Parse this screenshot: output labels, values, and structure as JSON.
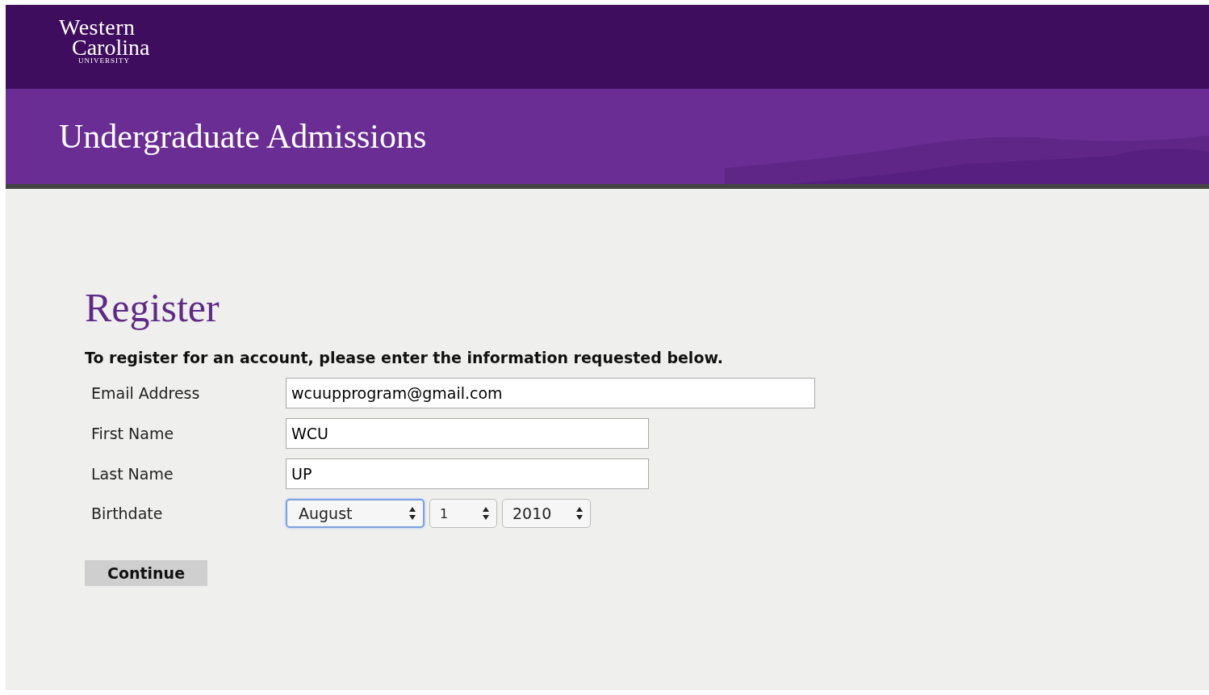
{
  "header": {
    "logo": {
      "line_1": "Western",
      "line_2": "Carolina",
      "line_3": "UNIVERSITY"
    }
  },
  "banner": {
    "title": "Undergraduate Admissions"
  },
  "form": {
    "title": "Register",
    "intro": "To register for an account, please enter the information requested below.",
    "fields": [
      {
        "label": "Email Address",
        "kind": "text",
        "value": "wcuupprogram@gmail.com"
      },
      {
        "label": "First Name",
        "kind": "text",
        "value": "WCU"
      },
      {
        "label": "Last Name",
        "kind": "text",
        "value": "UP"
      },
      {
        "label": "Birthdate",
        "kind": "date",
        "selects": [
          {
            "value": "August",
            "focused": true
          },
          {
            "value": "1",
            "focused": false
          },
          {
            "value": "2010",
            "focused": false
          }
        ]
      }
    ],
    "submit": "Continue"
  }
}
